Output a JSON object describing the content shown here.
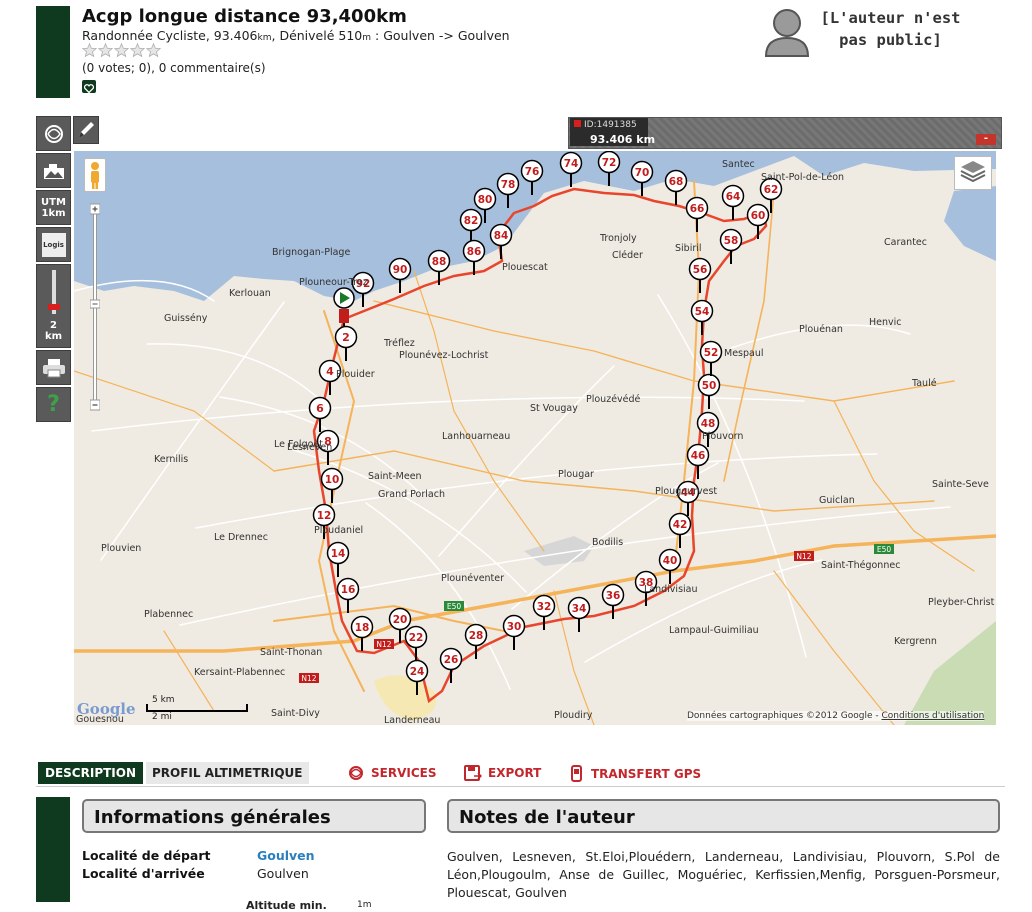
{
  "header": {
    "title": "Acgp longue distance 93,400km",
    "subtitle_type": "Randonnée Cycliste, 93.406",
    "subtitle_km_unit": "km",
    "subtitle_mid": ", Dénivelé 510",
    "subtitle_m_unit": "m",
    "subtitle_route": " : Goulven -> Goulven",
    "rating_stars": 5,
    "rating_filled": 0,
    "votes_text": "(0 votes; 0), 0 commentaire(s)",
    "author_note": "[L'auteur n'est pas public]"
  },
  "toolbar": {
    "utm_label": "UTM",
    "utm_value": "1km",
    "logis_label": "Logis",
    "zoom_value": "2",
    "zoom_unit": "km",
    "help_label": "?"
  },
  "route_box": {
    "id_label": "ID:1491385",
    "distance": "93.406 km",
    "close_label": "-"
  },
  "map": {
    "places": [
      "Brignogan-Plage",
      "Plouneour-Trez",
      "Kerlouan",
      "Guissény",
      "Kerlouan",
      "Tréflez",
      "Plounévez-Lochrist",
      "Plouescat",
      "Cléder",
      "Tronjoly",
      "Sibiril",
      "Santec",
      "Saint-Pol-de-Léon",
      "Carantec",
      "Henvic",
      "Plouénan",
      "Mespaul",
      "Taulé",
      "St Vougay",
      "Plouzévédé",
      "Lanhouarneau",
      "Plouvorn",
      "Kernilis",
      "Le Folgoët",
      "Lesneven",
      "Saint-Meen",
      "Grand Porlach",
      "Plougar",
      "Plougourvest",
      "Guiclan",
      "Sainte-Seve",
      "Le Drennec",
      "Plouvien",
      "Ploudaniel",
      "Bodilis",
      "Landivisiau",
      "Saint-Thégonnec",
      "Plabennec",
      "Plounéventer",
      "Pleyber-Christ",
      "Saint-Thonan",
      "Lampaul-Guimiliau",
      "Kergrenn",
      "Kersaint-Plabennec",
      "Landerneau",
      "Ploudiry",
      "Saint-Divy",
      "Gouesnou",
      "Kerlouan",
      "Plouider"
    ],
    "markers": [
      "2",
      "4",
      "6",
      "8",
      "10",
      "12",
      "14",
      "16",
      "18",
      "20",
      "22",
      "24",
      "26",
      "28",
      "30",
      "32",
      "34",
      "36",
      "38",
      "40",
      "42",
      "44",
      "46",
      "48",
      "50",
      "52",
      "54",
      "56",
      "58",
      "60",
      "62",
      "64",
      "66",
      "68",
      "70",
      "72",
      "74",
      "76",
      "78",
      "80",
      "82",
      "84",
      "86",
      "88",
      "90",
      "92"
    ],
    "scale_km": "5 km",
    "scale_mi": "2 mi",
    "google_label": "Google",
    "attribution": "Données cartographiques ©2012 Google - ",
    "attribution_link": "Conditions d'utilisation",
    "road_labels": [
      "N12",
      "E50",
      "N12",
      "E50",
      "N12"
    ],
    "route_color": "#e8452c",
    "road_color": "#f5b35a"
  },
  "tabs": {
    "description": "DESCRIPTION",
    "profil": "PROFIL ALTIMETRIQUE",
    "services": "SERVICES",
    "export": "EXPORT",
    "transfert": "TRANSFERT GPS"
  },
  "info": {
    "heading": "Informations générales",
    "depart_label": "Localité de départ",
    "depart_value": "Goulven",
    "arrivee_label": "Localité d'arrivée",
    "arrivee_value": "Goulven",
    "alt_label": "Altitude min.",
    "alt_value": "1m"
  },
  "notes": {
    "heading": "Notes de l'auteur",
    "text": "Goulven, Lesneven, St.Eloi,Plouédern, Landerneau, Landivisiau, Plouvorn, S.Pol de Léon,Plougoulm, Anse de Guillec, Moguériec, Kerfissien,Menfig, Porsguen-Porsmeur, Plouescat, Goulven"
  },
  "colors": {
    "brand_green": "#0f3a1f",
    "tab_red": "#c2272d",
    "link_blue": "#2a7fbe"
  }
}
